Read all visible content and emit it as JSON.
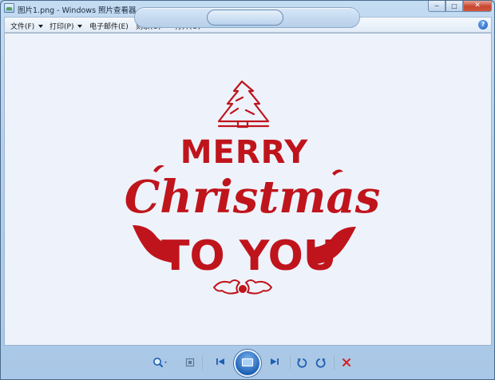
{
  "window": {
    "title": "图片1.png - Windows 照片查看器"
  },
  "title_controls": {
    "minimize": "─",
    "maximize": "□",
    "close": "✕"
  },
  "menu": {
    "items": [
      {
        "label": "文件(F)",
        "icon": "chevron-down-icon"
      },
      {
        "label": "打印(P)",
        "icon": "chevron-down-icon"
      },
      {
        "label": "电子邮件(E)"
      },
      {
        "label": "刻录(U)",
        "icon": "chevron-down-icon"
      },
      {
        "label": "打开(O)",
        "icon": "chevron-down-icon"
      }
    ],
    "help": "?"
  },
  "image": {
    "line1": "MERRY",
    "line2": "Christmas",
    "line3": "TO YOU",
    "colors": {
      "ink": "#c0141c",
      "background": "#eef3fb"
    }
  },
  "toolbar": {
    "icons": [
      "zoom-icon",
      "actual-size-icon",
      "previous-icon",
      "slideshow-icon",
      "next-icon",
      "rotate-left-icon",
      "rotate-right-icon",
      "delete-icon"
    ],
    "accent": "#1e62b8",
    "delete_color": "#d42020"
  }
}
